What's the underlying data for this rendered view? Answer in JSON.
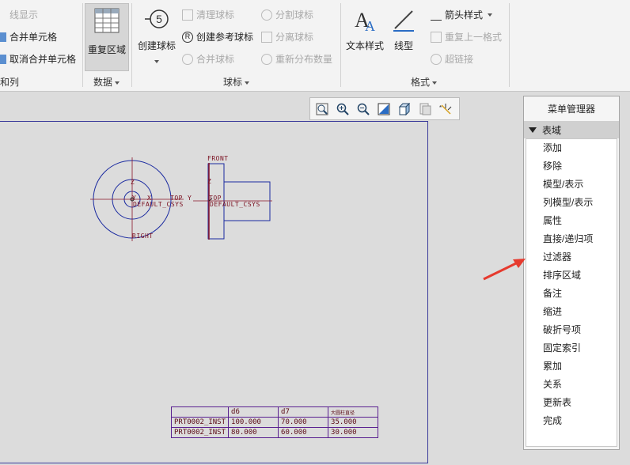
{
  "ribbon": {
    "left_partial": {
      "line_display": "线显示",
      "merge_cells": "合并单元格",
      "unmerge_cells": "取消合并单元格",
      "group_label": "和列"
    },
    "data_group": {
      "repeat_region": "重复区域",
      "group_label": "数据"
    },
    "balloon_group": {
      "create_balloon": "创建球标",
      "clean_balloons": "清理球标",
      "create_ref_balloon": "创建参考球标",
      "merge_balloons": "合并球标",
      "split_balloons": "分割球标",
      "detach_balloons": "分离球标",
      "redistribute_qty": "重新分布数量",
      "group_label": "球标"
    },
    "format_group": {
      "text_style": "文本样式",
      "line_style": "线型",
      "arrow_style": "箭头样式",
      "repeat_last_format": "重复上一格式",
      "hyperlink": "超链接",
      "group_label": "格式"
    }
  },
  "drawing": {
    "labels": {
      "front": "FRONT",
      "right": "RIGHT",
      "top": "TOP",
      "top2": "TOP",
      "csys1": "DEFAULT_CSYS",
      "csys2": "DEFAULT_CSYS",
      "z1": "Z",
      "z2": "Z",
      "y1": "Y",
      "x1": "X",
      "y2": "Y"
    },
    "table": {
      "headers": [
        "",
        "d6",
        "d7",
        "大圆柱直径"
      ],
      "rows": [
        [
          "PRT0002_INST",
          "100.000",
          "70.000",
          "35.000"
        ],
        [
          "PRT0002_INST",
          "80.000",
          "60.000",
          "30.000"
        ]
      ]
    }
  },
  "menu_manager": {
    "title": "菜单管理器",
    "section": "表域",
    "items": [
      "添加",
      "移除",
      "模型/表示",
      "列模型/表示",
      "属性",
      "直接/递归项",
      "过滤器",
      "排序区域",
      "备注",
      "缩进",
      "破折号项",
      "固定索引",
      "累加",
      "关系",
      "更新表",
      "完成"
    ]
  },
  "colors": {
    "accent_arrow": "#e63a2e",
    "sheet_border": "#3a3a9a",
    "geometry": "#1a2aa0",
    "datum": "#8a1428"
  }
}
